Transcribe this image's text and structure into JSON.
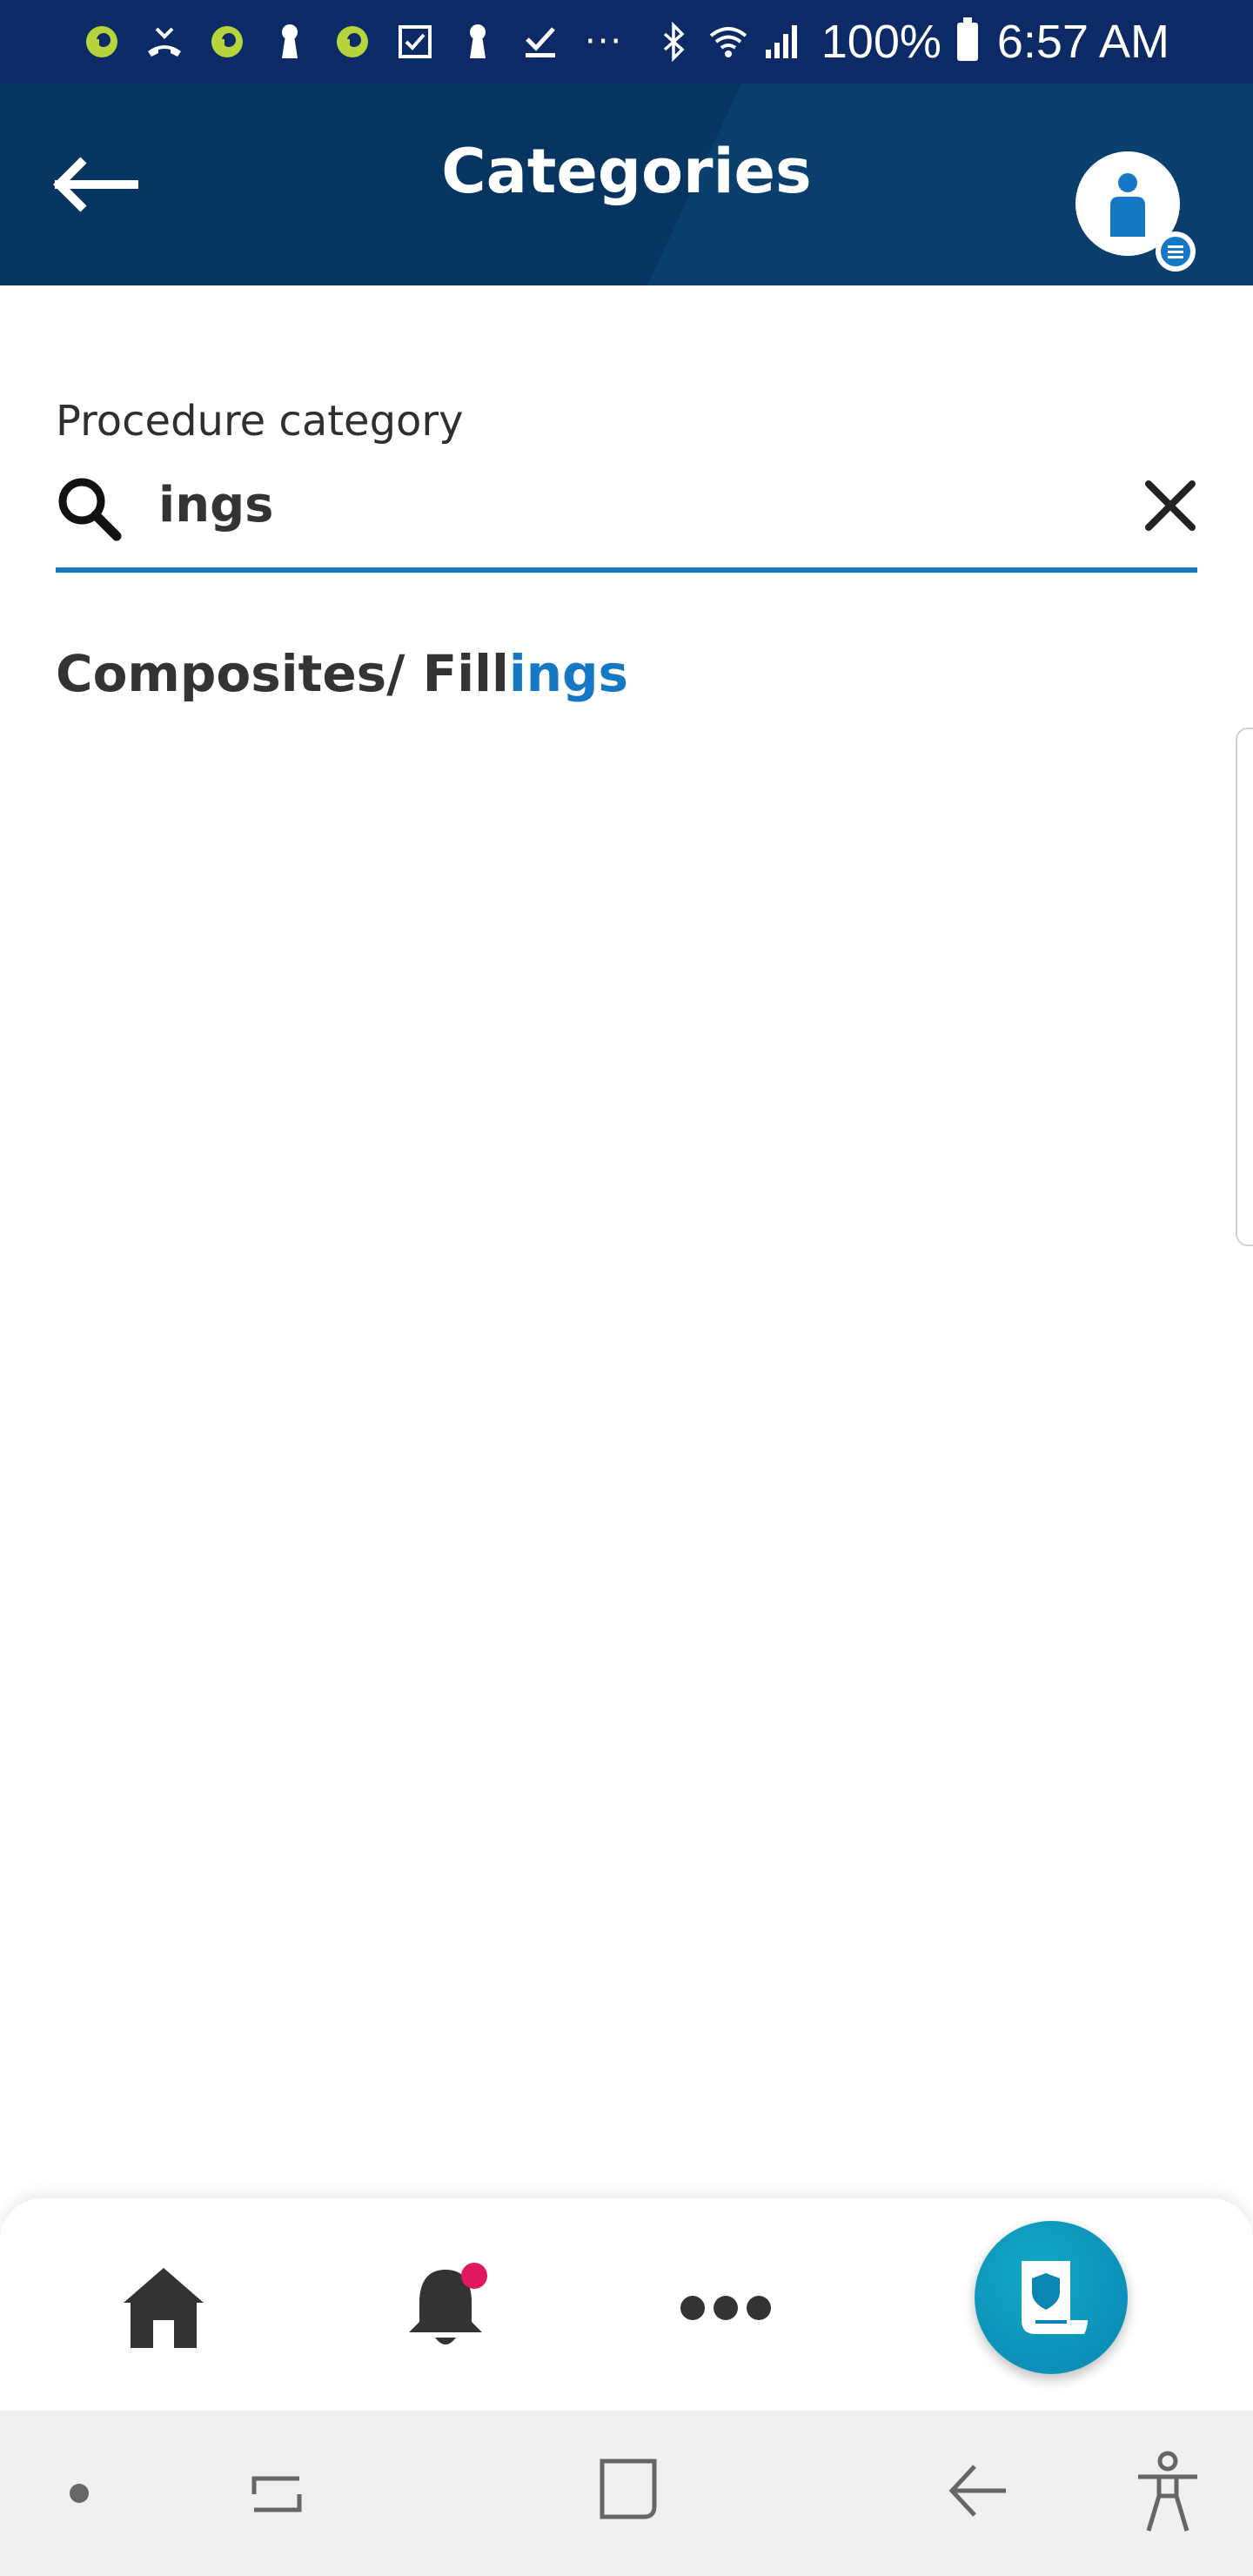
{
  "status_bar": {
    "battery": "100%",
    "time": "6:57 AM",
    "notification_icons": [
      "app-icon",
      "missed-call-icon",
      "app-icon",
      "keyhole-icon",
      "app-icon",
      "checkbox-icon",
      "keyhole-icon",
      "download-done-icon"
    ],
    "more": "···"
  },
  "header": {
    "title": "Categories",
    "background_color": "#063562"
  },
  "search": {
    "label": "Procedure category",
    "value": "ings",
    "accent_color": "#1578c4"
  },
  "results": [
    {
      "prefix": "Composites/ Fill",
      "match": "ings"
    }
  ],
  "bottom_nav": {
    "items": [
      "home-icon",
      "bell-icon",
      "more-icon",
      "policy-card-icon"
    ],
    "notification_dot_color": "#e0185f"
  },
  "system_nav": {
    "items": [
      "dot-icon",
      "recent-apps-icon",
      "home-square-icon",
      "back-icon",
      "accessibility-icon"
    ]
  }
}
